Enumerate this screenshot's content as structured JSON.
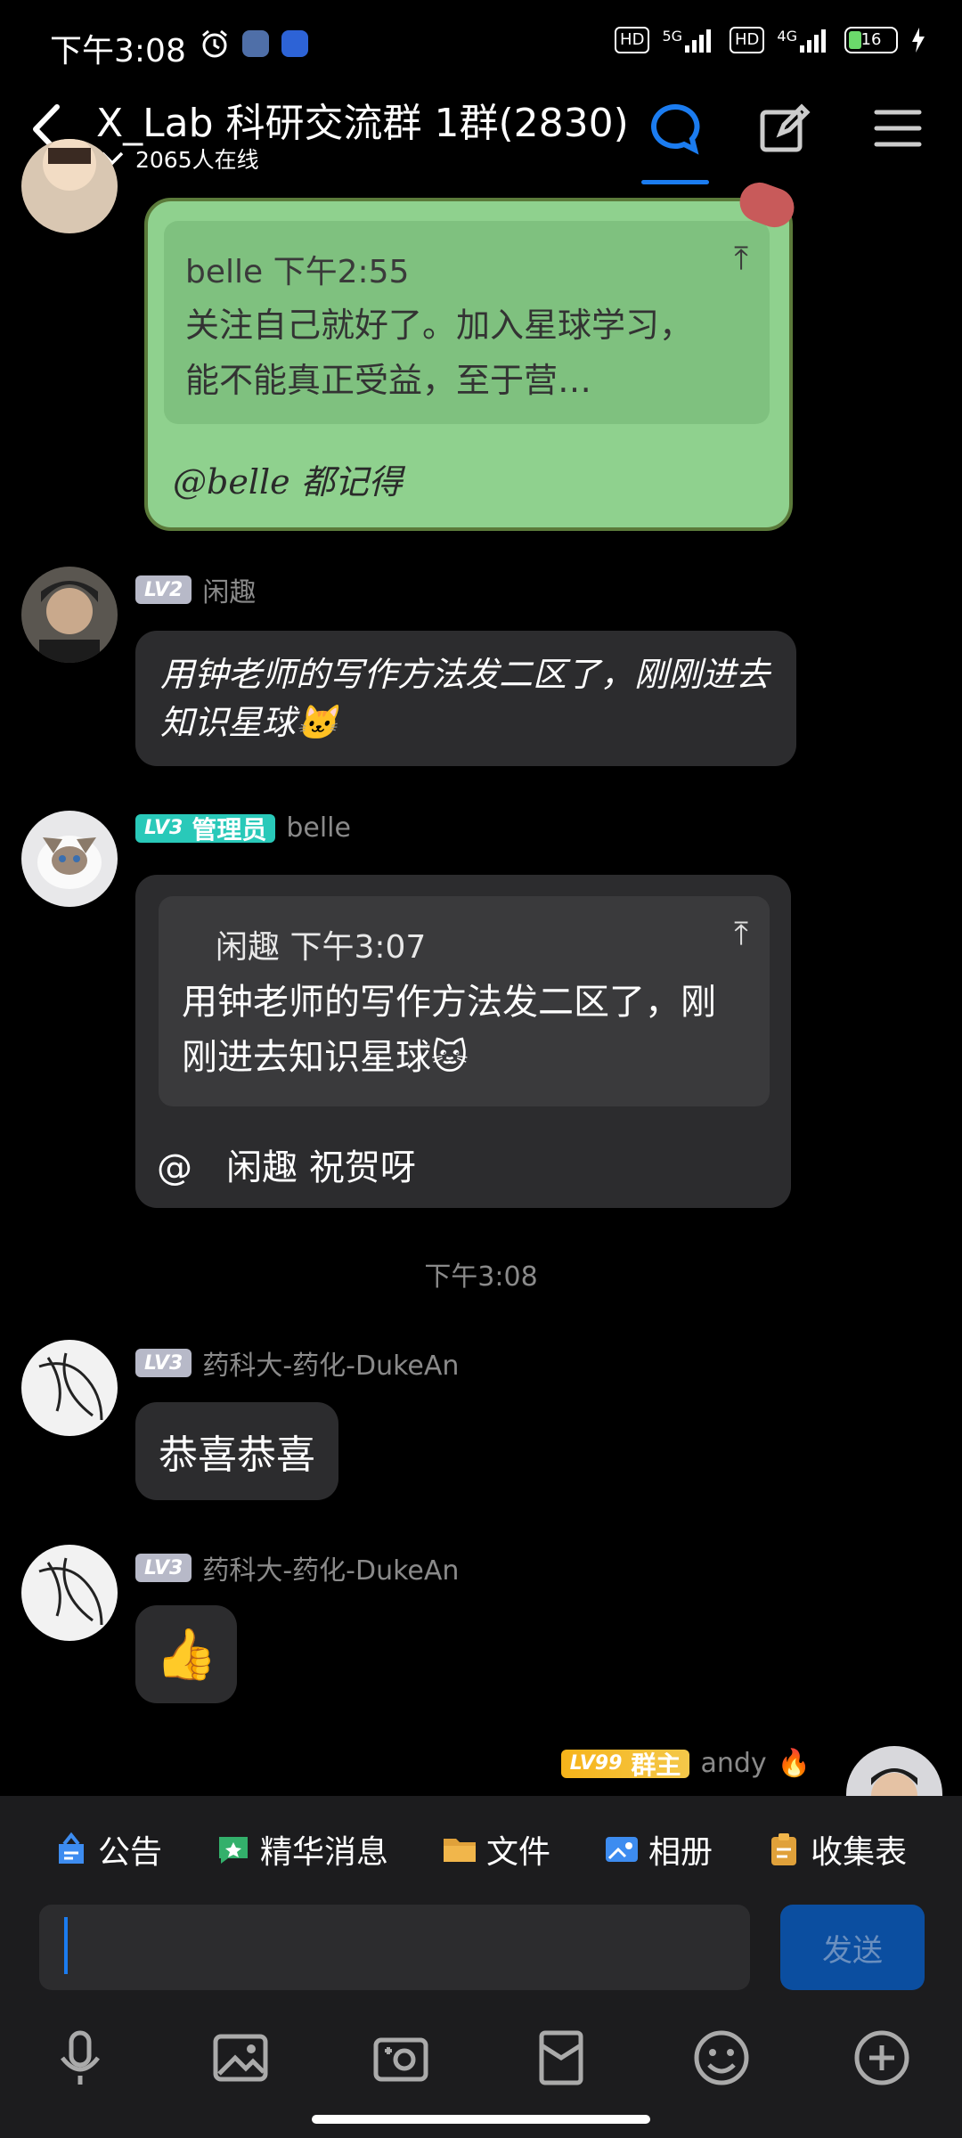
{
  "status_bar": {
    "time": "下午3:08",
    "net1": "5G",
    "net2": "4G",
    "hd1": "HD",
    "hd2": "HD",
    "battery": "16"
  },
  "header": {
    "title": "X_Lab 科研交流群 1群(2830)",
    "online": "2065人在线"
  },
  "messages": {
    "m1": {
      "quote_author_time": "belle 下午2:55",
      "quote_text": "关注自己就好了。加入星球学习，能不能真正受益，至于营…",
      "body": "@belle  都记得"
    },
    "m2": {
      "level": "LV2",
      "name": "闲趣",
      "body": "用钟老师的写作方法发二区了，刚刚进去知识星球🐱"
    },
    "m3": {
      "level": "LV3",
      "role": "管理员",
      "name": "belle",
      "quote_author_time": "闲趣 下午3:07",
      "quote_text": "用钟老师的写作方法发二区了，刚刚进去知识星球🐱",
      "body": "@   闲趣 祝贺呀"
    },
    "timestamp": "下午3:08",
    "m4": {
      "level": "LV3",
      "name": "药科大-药化-DukeAn",
      "body": "恭喜恭喜"
    },
    "m5": {
      "level": "LV3",
      "name": "药科大-药化-DukeAn",
      "body": "👍"
    },
    "m6": {
      "level": "LV99",
      "role": "群主",
      "name": "andy",
      "emoji": "🔥"
    }
  },
  "shortcuts": [
    {
      "label": "公告",
      "icon": "announcement-icon",
      "color": "#3d8cf0"
    },
    {
      "label": "精华消息",
      "icon": "essence-icon",
      "color": "#33b06b"
    },
    {
      "label": "文件",
      "icon": "folder-icon",
      "color": "#e0a13a"
    },
    {
      "label": "相册",
      "icon": "album-icon",
      "color": "#3d8cf0"
    },
    {
      "label": "收集表",
      "icon": "clipboard-icon",
      "color": "#e0a13a"
    }
  ],
  "composer": {
    "send_label": "发送"
  },
  "colors": {
    "accent": "#1b7cf0",
    "bubble": "#2c2c2e",
    "green_bubble": "#8fd18e"
  }
}
